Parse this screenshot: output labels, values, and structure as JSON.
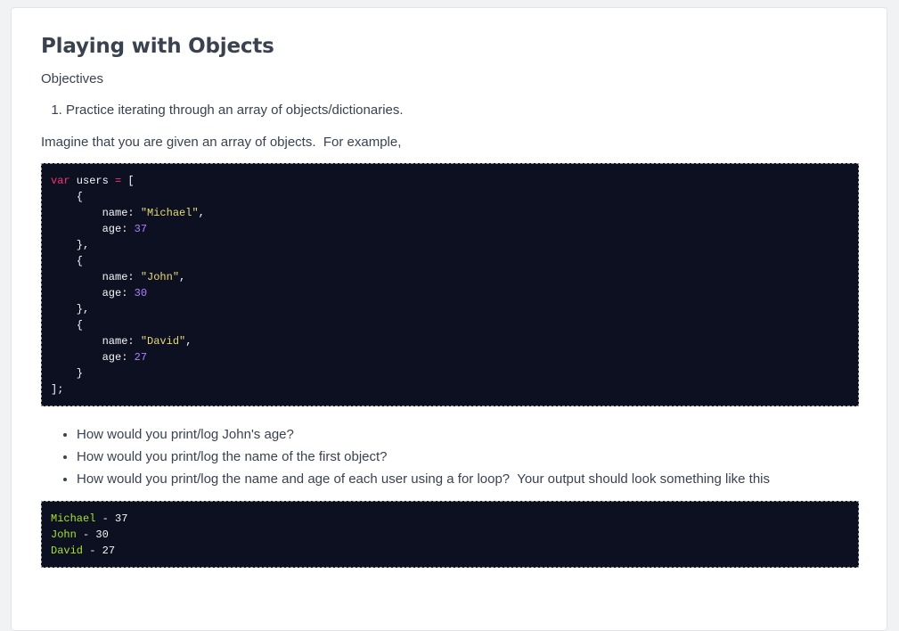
{
  "page": {
    "title": "Playing with Objects",
    "objectives_heading": "Objectives",
    "objectives": [
      "Practice iterating through an array of objects/dictionaries."
    ],
    "intro": "Imagine that you are given an array of objects.  For example,",
    "code": {
      "decl_keyword": "var",
      "decl_name": " users ",
      "decl_eq": "=",
      "decl_open": " [",
      "open_brace": "    {",
      "close_brace_comma": "    },",
      "close_brace": "    }",
      "name_key": "        name: ",
      "age_key": "        age: ",
      "comma": ",",
      "end": "];",
      "users": [
        {
          "name": "\"Michael\"",
          "age": "37"
        },
        {
          "name": "\"John\"",
          "age": "30"
        },
        {
          "name": "\"David\"",
          "age": "27"
        }
      ]
    },
    "questions": [
      "How would you print/log John's age?",
      "How would you print/log the name of the first object?",
      "How would you print/log the name and age of each user using a for loop?  Your output should look something like this"
    ],
    "output": {
      "separator": " - ",
      "rows": [
        {
          "name": "Michael",
          "age": "37"
        },
        {
          "name": "John",
          "age": "30"
        },
        {
          "name": "David",
          "age": "27"
        }
      ]
    }
  },
  "colors": {
    "background": "#0c1021",
    "keyword": "#fb2f6f",
    "string": "#e6db74",
    "number": "#ae81ff",
    "output_name": "#a6e22e",
    "text": "#3a4250"
  }
}
